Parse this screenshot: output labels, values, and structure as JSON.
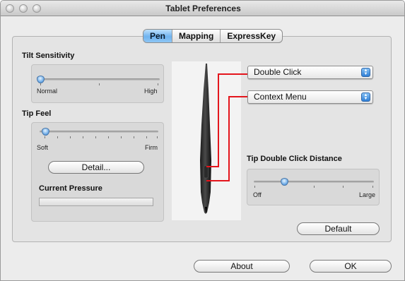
{
  "window": {
    "title": "Tablet Preferences"
  },
  "tabs": [
    {
      "label": "Pen",
      "selected": true
    },
    {
      "label": "Mapping",
      "selected": false
    },
    {
      "label": "ExpressKey",
      "selected": false
    }
  ],
  "tilt": {
    "label": "Tilt Sensitivity",
    "min_label": "Normal",
    "max_label": "High",
    "level": 0.0
  },
  "tip_feel": {
    "label": "Tip Feel",
    "min_label": "Soft",
    "max_label": "Firm",
    "level": 0.08,
    "detail_button": "Detail..."
  },
  "pressure": {
    "label": "Current Pressure",
    "level": 0.0
  },
  "buttons": {
    "upper": "Double Click",
    "lower": "Context Menu"
  },
  "tip_double_click": {
    "label": "Tip Double Click Distance",
    "min_label": "Off",
    "max_label": "Large",
    "level": 0.25
  },
  "actions": {
    "default": "Default",
    "about": "About",
    "ok": "OK"
  },
  "colors": {
    "accent": "#6fb3ef",
    "pointer_line": "#e4151c"
  },
  "icons": {
    "popup_arrows": "up-down-arrows-icon",
    "traffic_lights": "window-control-icon"
  }
}
